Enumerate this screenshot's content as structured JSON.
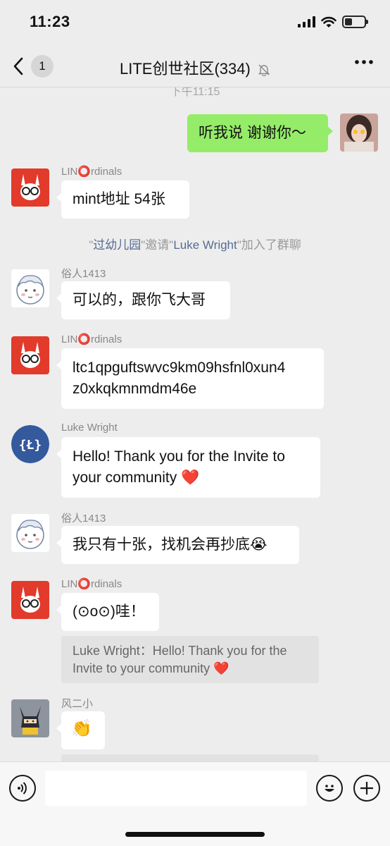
{
  "status_bar": {
    "time": "11:23"
  },
  "nav": {
    "unread_count": "1",
    "title": "LITE创世社区(334)"
  },
  "chat": {
    "timestamp": "下午11:15",
    "messages": [
      {
        "sender": "",
        "text": "听我说 谢谢你～",
        "side": "right"
      },
      {
        "sender": "LIN⭕rdinals",
        "text": "mint地址 54张"
      },
      {
        "system": true,
        "parts": [
          "\"",
          "过幼儿园",
          "\"邀请\"",
          "Luke Wright",
          "\"加入了群聊"
        ]
      },
      {
        "sender": "俗人1413",
        "text": "可以的，跟你飞大哥"
      },
      {
        "sender": "LIN⭕rdinals",
        "text_line1": "ltc1qpguftswvc9km09hsfnl0xun4",
        "text_line2": "z0xkqkmnmdm46e"
      },
      {
        "sender": "Luke Wright",
        "text_line1": "Hello! Thank you for the Invite to",
        "text_line2": "your community",
        "emoji": "❤️"
      },
      {
        "sender": "俗人1413",
        "text": "我只有十张，找机会再抄底",
        "emoji": "😭"
      },
      {
        "sender": "LIN⭕rdinals",
        "text": "(⊙o⊙)哇！",
        "quote_line1": "Luke Wright：Hello! Thank you for the",
        "quote_line2": "Invite to your community",
        "quote_emoji": "❤️"
      },
      {
        "sender": "风二小",
        "emoji": "👏"
      }
    ]
  },
  "input": {
    "value": ""
  },
  "colors": {
    "bubble_self": "#95ec69",
    "background": "#ededed",
    "link": "#576b95"
  }
}
